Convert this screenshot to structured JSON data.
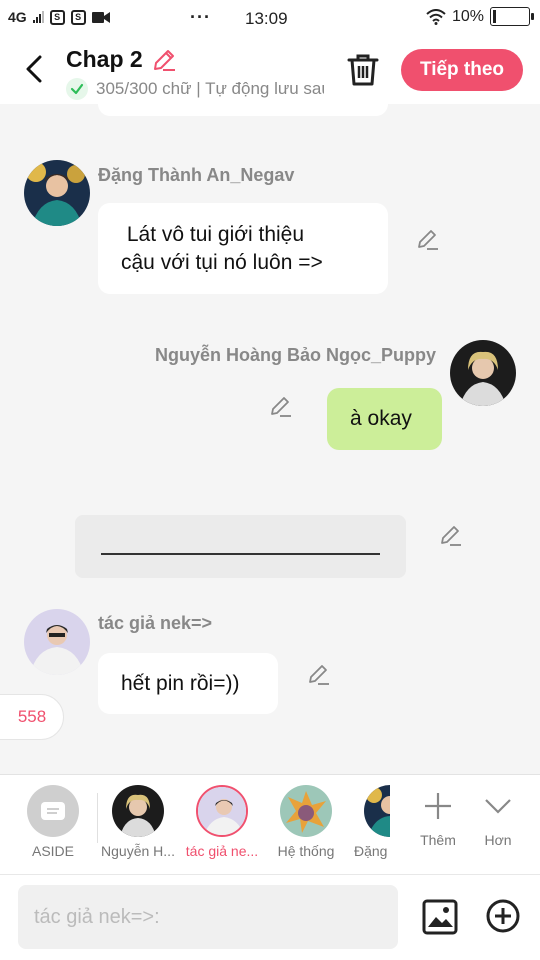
{
  "status_bar": {
    "network": "4G",
    "time": "13:09",
    "battery": "10%",
    "battery_level": 0.1,
    "icons": [
      "signal-icon",
      "sim-s-icon",
      "sim-s-icon",
      "video-icon",
      "more-dots-icon",
      "wifi-icon",
      "battery-icon"
    ]
  },
  "header": {
    "title": "Chap 2",
    "subtitle": "305/300 chữ | Tự động lưu sau",
    "next_label": "Tiếp theo",
    "icons": [
      "back-arrow-icon",
      "pencil-icon",
      "check-icon",
      "trash-icon"
    ]
  },
  "messages": [
    {
      "sender": "Đặng Thành An_Negav",
      "text": " Lát vô tui giới thiệu\ncậu với tụi nó luôn =>",
      "side": "left"
    },
    {
      "sender": "Nguyễn Hoàng Bảo Ngọc_Puppy",
      "text": "à okay",
      "side": "right"
    },
    {
      "sender": "",
      "text": "",
      "side": "narration"
    },
    {
      "sender": "tác giả nek=>",
      "text": "hết pin rồi=))",
      "side": "left"
    }
  ],
  "count_badge": "558",
  "characters": [
    {
      "name": "ASIDE"
    },
    {
      "name": "Nguyễn H..."
    },
    {
      "name": "tác giả ne...",
      "selected": true
    },
    {
      "name": "Hệ thống"
    },
    {
      "name": "Đặng"
    }
  ],
  "tools": {
    "add_label": "Thêm",
    "more_label": "Hơn"
  },
  "input": {
    "placeholder": "tác giả nek=>:"
  },
  "colors": {
    "accent": "#f0506e",
    "green_bubble": "#ccee99",
    "background": "#f5f5f5"
  }
}
